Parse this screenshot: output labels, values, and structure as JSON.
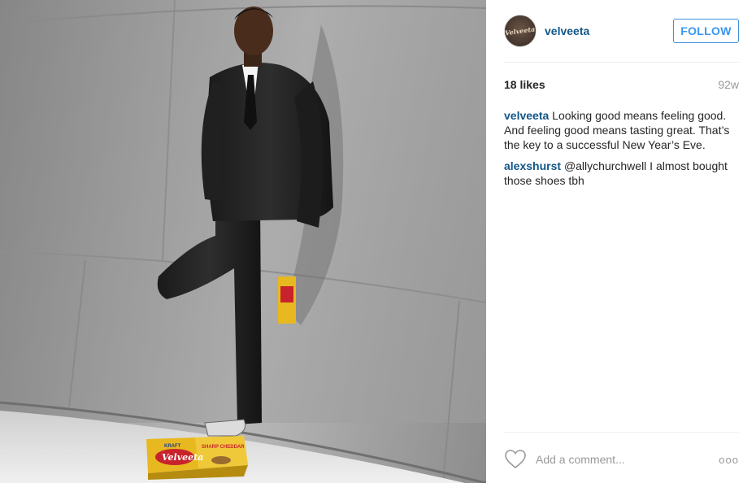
{
  "post": {
    "username": "velveeta",
    "avatar_text": "Velveeta",
    "follow_label": "FOLLOW",
    "likes": "18 likes",
    "age": "92w",
    "caption": {
      "author": "velveeta",
      "text": "Looking good means feeling good. And feeling good means tasting great. That’s the key to a successful New Year’s Eve."
    },
    "comments": [
      {
        "author": "alexshurst",
        "text": "@allychurchwell I almost bought those shoes tbh"
      }
    ],
    "add_comment_placeholder": "Add a comment...",
    "more_label": "ooo"
  },
  "photo": {
    "box_front_brand": "Velveeta",
    "box_front_small": "KRAFT",
    "box_side_label": "SHARP CHEDDAR"
  },
  "colors": {
    "accent": "#3897f0",
    "link": "#125688",
    "muted": "#999999",
    "box_yellow": "#e8b820",
    "box_red": "#c8232c"
  },
  "icons": [
    "heart-icon",
    "more-options-icon"
  ]
}
